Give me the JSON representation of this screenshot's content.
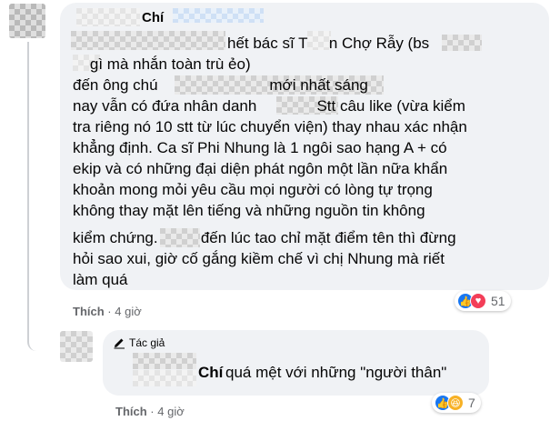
{
  "comment": {
    "author": "Chí",
    "lines": [
      "hết bác sĩ T     n Chợ Rẫy (bs",
      "    gì mà nhắn toàn trù ẻo)",
      "đến ông chú                          mới nhất sáng",
      "nay vẫn có đứa nhân danh              Stt câu like (vừa kiểm",
      "tra riêng nó 10 stt từ lúc chuyển viện) thay nhau xác nhận",
      "khẳng định. Ca sĩ Phi Nhung là 1 ngôi sao hạng A + có",
      "ekip và có những đại diện phát ngôn một lần nữa khẩn",
      "khoản mong mỏi yêu cầu mọi người có lòng tự trọng",
      "không thay mặt lên tiếng và những nguồn tin không",
      "kiểm chứng.          đến lúc tao chỉ mặt điểm tên thì đừng",
      "hỏi sao xui, giờ cố gắng kiềm chế vì chị Nhung mà riết",
      "làm quá"
    ],
    "reaction_count": "51",
    "like_label": "Thích",
    "time": "4 giờ"
  },
  "reply": {
    "badge": "Tác giả",
    "author": "Chí",
    "text": "quá mệt với những \"người thân\"",
    "reaction_count": "7",
    "like_label": "Thích",
    "time": "4 giờ"
  },
  "icons": [
    "like-icon",
    "love-icon",
    "haha-icon",
    "pen-icon"
  ],
  "colors": {
    "like": "#1877f2",
    "love": "#f33e58",
    "haha": "#f7b125",
    "bubble": "#f0f2f5",
    "meta": "#65676b"
  }
}
